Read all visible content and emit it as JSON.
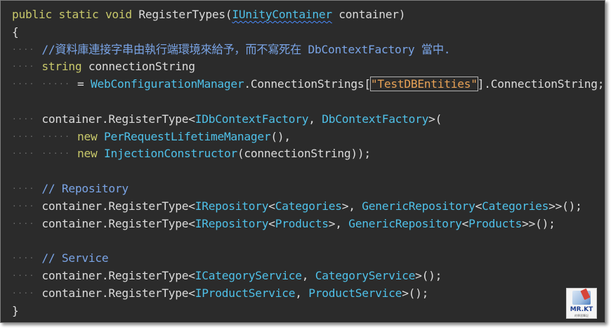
{
  "code": {
    "lines": [
      {
        "indent": "",
        "tokens": [
          {
            "t": "public static void",
            "c": "kw"
          },
          {
            "t": " RegisterTypes(",
            "c": "pl"
          },
          {
            "t": "IUnityContainer",
            "c": "ty",
            "squiggle": true
          },
          {
            "t": " container)",
            "c": "pl"
          }
        ]
      },
      {
        "indent": "",
        "tokens": [
          {
            "t": "{",
            "c": "pl"
          }
        ]
      },
      {
        "indent": "1",
        "tokens": [
          {
            "t": "//資料庫連接字串由執行端環境來給予，而不寫死在 DbContextFactory 當中.",
            "c": "cm"
          }
        ]
      },
      {
        "indent": "1",
        "tokens": [
          {
            "t": "string",
            "c": "kw"
          },
          {
            "t": " connectionString",
            "c": "pl"
          }
        ]
      },
      {
        "indent": "2",
        "tokens": [
          {
            "t": "= ",
            "c": "pl"
          },
          {
            "t": "WebConfigurationManager",
            "c": "ty"
          },
          {
            "t": ".ConnectionStrings[",
            "c": "pl"
          },
          {
            "t": "\"TestDBEntities\"",
            "c": "st",
            "boxed": true
          },
          {
            "t": "].ConnectionString;",
            "c": "pl"
          }
        ]
      },
      {
        "indent": "",
        "tokens": []
      },
      {
        "indent": "1",
        "tokens": [
          {
            "t": "container.RegisterType<",
            "c": "pl"
          },
          {
            "t": "IDbContextFactory",
            "c": "ty"
          },
          {
            "t": ", ",
            "c": "pl"
          },
          {
            "t": "DbContextFactory",
            "c": "ty"
          },
          {
            "t": ">(",
            "c": "pl"
          }
        ]
      },
      {
        "indent": "2",
        "tokens": [
          {
            "t": "new",
            "c": "kw"
          },
          {
            "t": " ",
            "c": "pl"
          },
          {
            "t": "PerRequestLifetimeManager",
            "c": "ty"
          },
          {
            "t": "(),",
            "c": "pl"
          }
        ]
      },
      {
        "indent": "2",
        "tokens": [
          {
            "t": "new",
            "c": "kw"
          },
          {
            "t": " ",
            "c": "pl"
          },
          {
            "t": "InjectionConstructor",
            "c": "ty"
          },
          {
            "t": "(connectionString));",
            "c": "pl"
          }
        ]
      },
      {
        "indent": "",
        "tokens": []
      },
      {
        "indent": "1",
        "tokens": [
          {
            "t": "// Repository",
            "c": "cm"
          }
        ]
      },
      {
        "indent": "1",
        "tokens": [
          {
            "t": "container.RegisterType<",
            "c": "pl"
          },
          {
            "t": "IRepository",
            "c": "ty"
          },
          {
            "t": "<",
            "c": "pl"
          },
          {
            "t": "Categories",
            "c": "ty"
          },
          {
            "t": ">, ",
            "c": "pl"
          },
          {
            "t": "GenericRepository",
            "c": "ty"
          },
          {
            "t": "<",
            "c": "pl"
          },
          {
            "t": "Categories",
            "c": "ty"
          },
          {
            "t": ">>();",
            "c": "pl"
          }
        ]
      },
      {
        "indent": "1",
        "tokens": [
          {
            "t": "container.RegisterType<",
            "c": "pl"
          },
          {
            "t": "IRepository",
            "c": "ty"
          },
          {
            "t": "<",
            "c": "pl"
          },
          {
            "t": "Products",
            "c": "ty"
          },
          {
            "t": ">, ",
            "c": "pl"
          },
          {
            "t": "GenericRepository",
            "c": "ty"
          },
          {
            "t": "<",
            "c": "pl"
          },
          {
            "t": "Products",
            "c": "ty"
          },
          {
            "t": ">>();",
            "c": "pl"
          }
        ]
      },
      {
        "indent": "",
        "tokens": []
      },
      {
        "indent": "1",
        "tokens": [
          {
            "t": "// Service",
            "c": "cm"
          }
        ]
      },
      {
        "indent": "1",
        "tokens": [
          {
            "t": "container.RegisterType<",
            "c": "pl"
          },
          {
            "t": "ICategoryService",
            "c": "ty"
          },
          {
            "t": ", ",
            "c": "pl"
          },
          {
            "t": "CategoryService",
            "c": "ty"
          },
          {
            "t": ">();",
            "c": "pl"
          }
        ]
      },
      {
        "indent": "1",
        "tokens": [
          {
            "t": "container.RegisterType<",
            "c": "pl"
          },
          {
            "t": "IProductService",
            "c": "ty"
          },
          {
            "t": ", ",
            "c": "pl"
          },
          {
            "t": "ProductService",
            "c": "ty"
          },
          {
            "t": ">();",
            "c": "pl"
          }
        ]
      },
      {
        "indent": "",
        "tokens": [
          {
            "t": "}",
            "c": "pl"
          }
        ]
      }
    ]
  },
  "logo": {
    "name": "MR.KT",
    "tagline": "的學習筆記"
  },
  "colors": {
    "background": "#2b2b2b",
    "keyword": "#c8c86a",
    "type": "#4fc1e9",
    "plain": "#dcdcdc",
    "comment": "#7aa4e6",
    "string": "#e8a256"
  }
}
